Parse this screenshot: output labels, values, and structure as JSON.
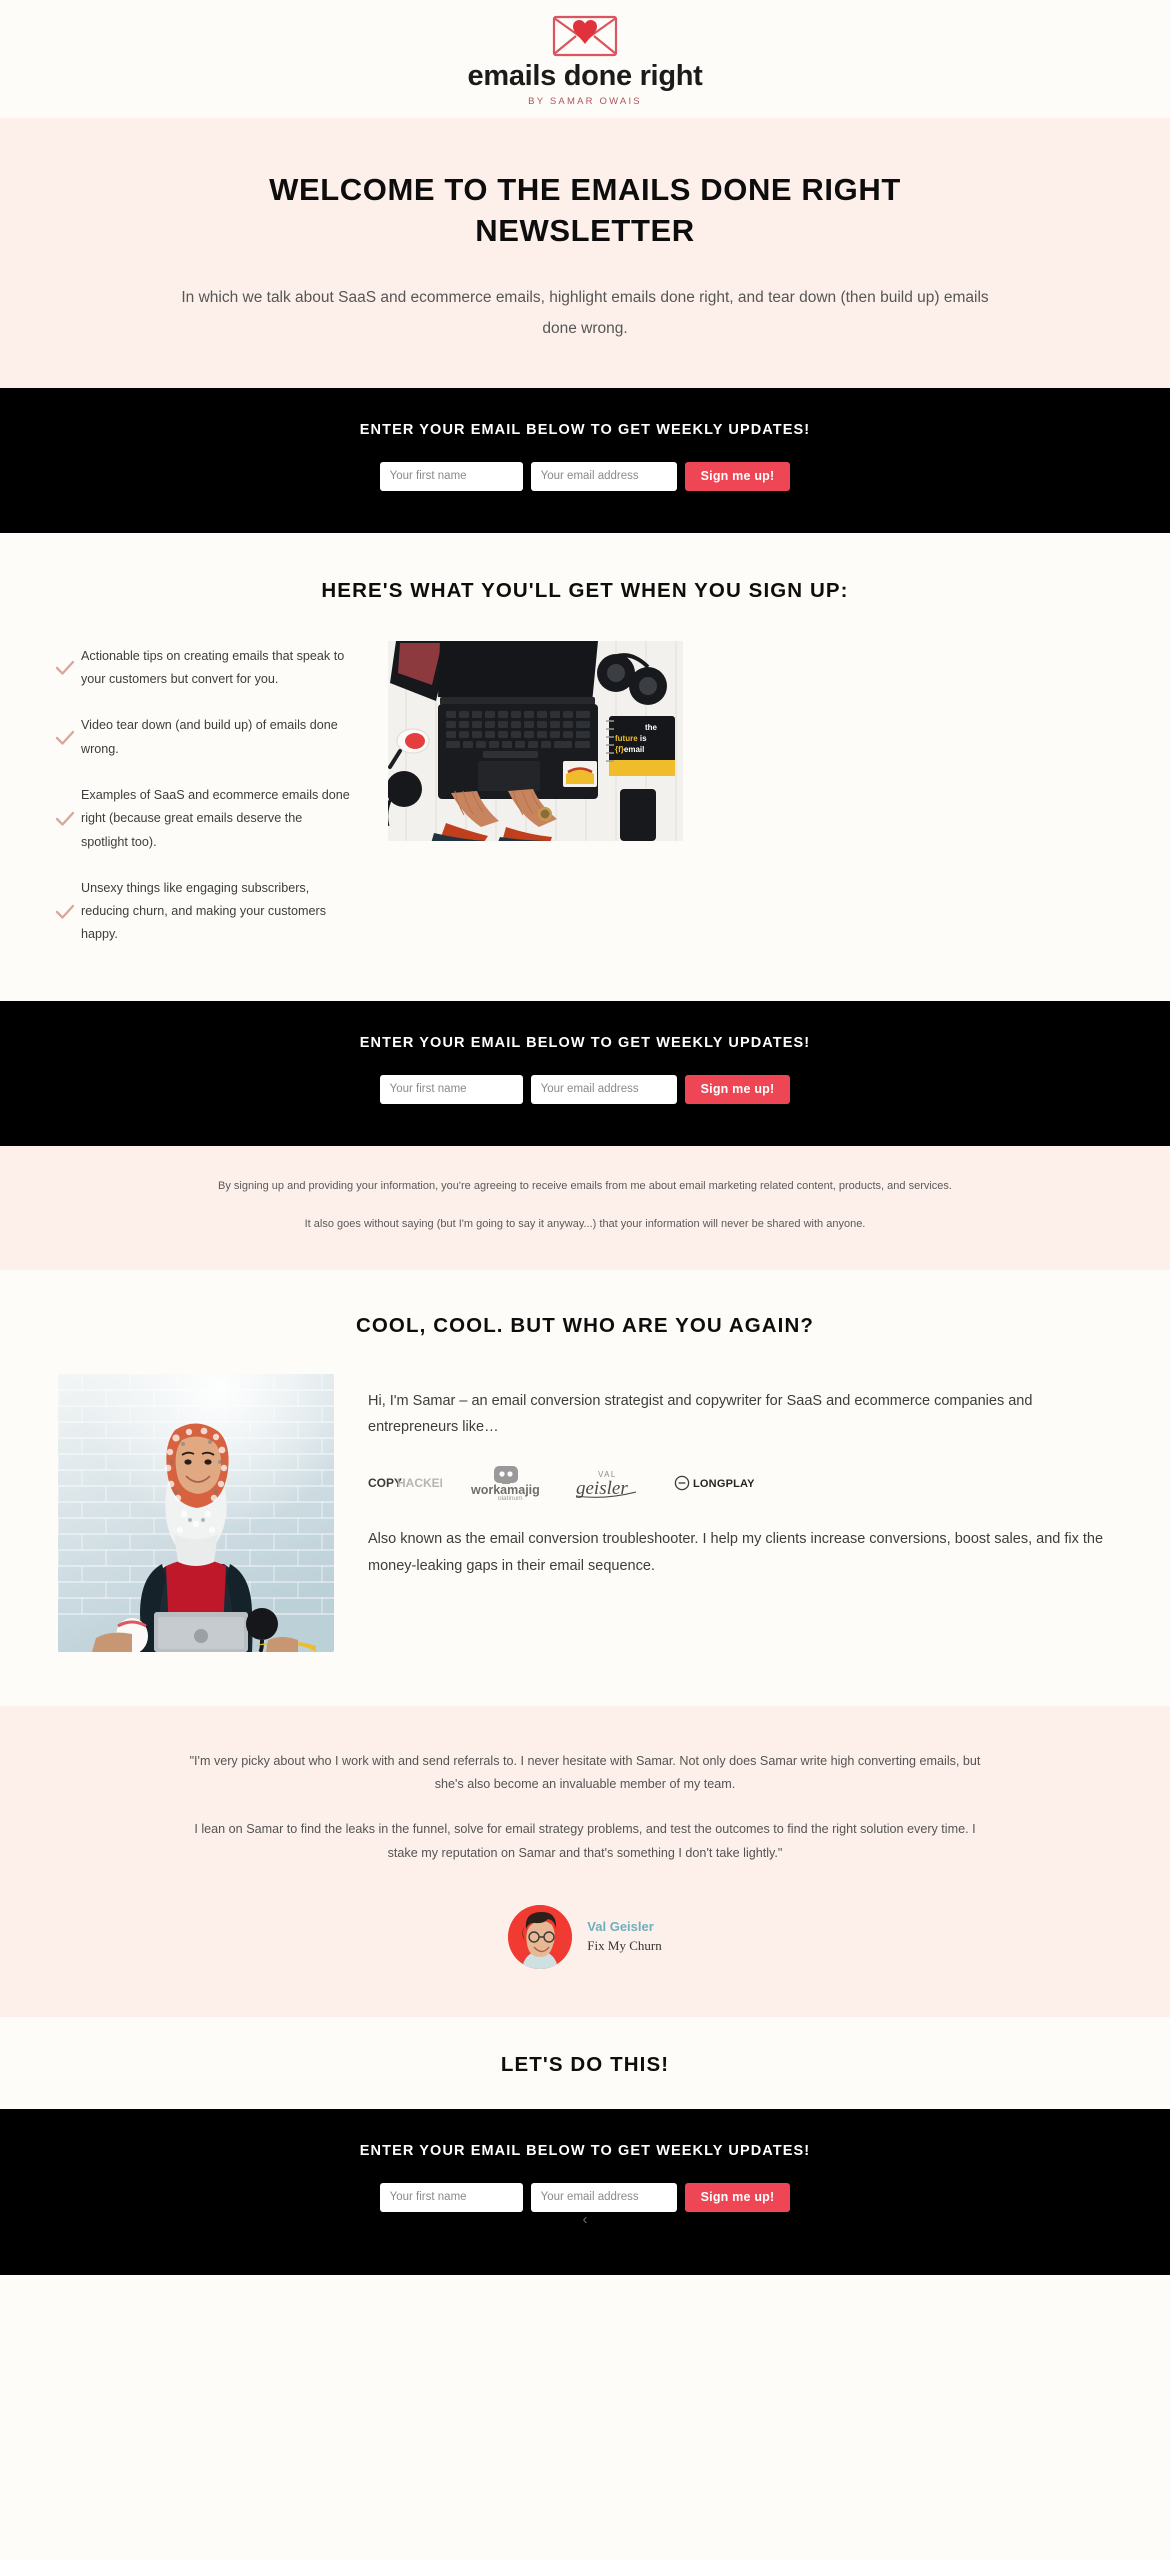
{
  "brand": {
    "logo_icon": "envelope-heart-icon",
    "wordmark": "emails done right",
    "byline": "BY SAMAR OWAIS",
    "accent_red": "#EE4655",
    "accent_pink_bg": "#FDF0EB",
    "offwhite_bg": "#FDFCF8",
    "teal": "#6FAFBD"
  },
  "hero": {
    "title": "WELCOME TO THE EMAILS DONE RIGHT NEWSLETTER",
    "subtitle": "In which we talk about SaaS and ecommerce emails, highlight emails done right, and tear down (then build up) emails done wrong."
  },
  "optin": {
    "heading": "ENTER YOUR EMAIL BELOW TO GET WEEKLY UPDATES!",
    "first_name_placeholder": "Your first name",
    "email_placeholder": "Your email address",
    "submit_label": "Sign me up!",
    "first_name_value": "",
    "email_value": ""
  },
  "benefits": {
    "title": "HERE'S WHAT YOU'LL GET WHEN YOU SIGN UP:",
    "items": [
      "Actionable tips on creating emails that speak to your customers but convert for you.",
      "Video tear down (and build up) of emails done wrong.",
      "Examples of SaaS and ecommerce emails done right (because great emails deserve the spotlight too).",
      "Unsexy things like engaging subscribers, reducing churn, and making your customers happy."
    ],
    "photo_alt": "hands-typing-on-laptop-photo",
    "photo_notebook_text": "the future is {f}email"
  },
  "disclaimer": {
    "line1": "By signing up and providing your information, you're agreeing to receive emails from me about email marketing related content, products, and services.",
    "line2": "It also goes without saying (but I'm going to say it anyway...) that your information will never be shared with anyone."
  },
  "bio": {
    "title": "COOL, COOL. BUT WHO ARE YOU AGAIN?",
    "photo_alt": "samar-owais-portrait-photo",
    "paragraph1": "Hi, I'm Samar – an email conversion strategist and copywriter for SaaS and ecommerce companies and entrepreneurs like…",
    "paragraph2": "Also known as the email conversion troubleshooter. I help my clients increase conversions, boost sales, and fix the money-leaking gaps in their email sequence.",
    "client_logos": [
      {
        "name": "COPYHACKERS",
        "bold_part": "COPY",
        "light_part": "HACKERS"
      },
      {
        "name": "workamajig",
        "subtitle": "platinum"
      },
      {
        "name": "VAL geisler",
        "top": "VAL",
        "script": "geisler"
      },
      {
        "name": "LONGPLAY",
        "label": "LONGPLAY"
      }
    ]
  },
  "testimonial": {
    "quote1": "\"I'm very picky about who I work with and send referrals to. I never hesitate with Samar. Not only does Samar write high converting emails, but she's also become an invaluable member of my team.",
    "quote2": "I lean on Samar to find the leaks in the funnel, solve for email strategy problems, and test the outcomes to find the right solution every time. I stake my reputation on Samar and that's something I don't take lightly.\"",
    "author_name": "Val Geisler",
    "author_company": "Fix My Churn",
    "author_avatar_alt": "val-geisler-avatar"
  },
  "closing": {
    "title": "LET'S DO THIS!",
    "footer_arrow": "‹"
  }
}
